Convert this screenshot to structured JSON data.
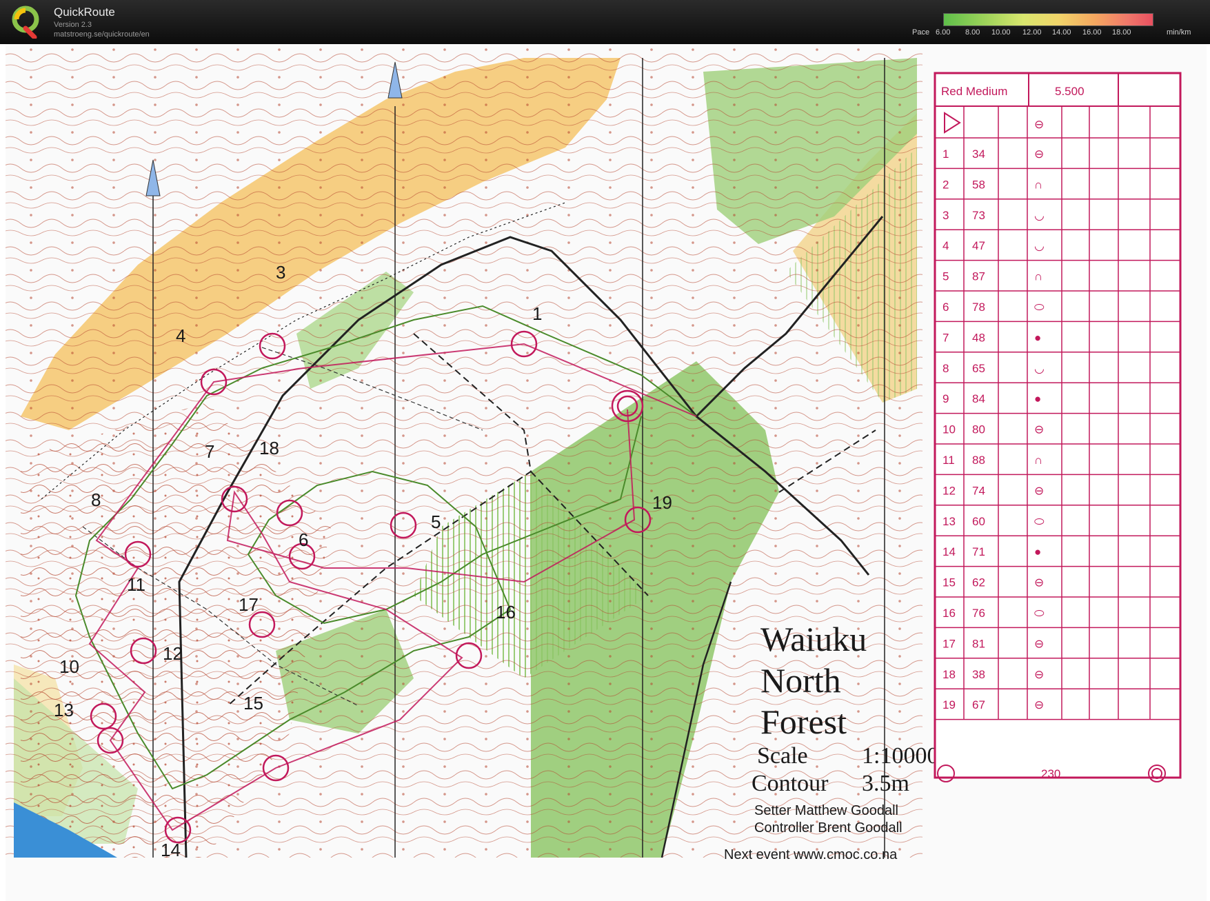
{
  "app": {
    "name": "QuickRoute",
    "version": "Version 2.3",
    "url": "matstroeng.se/quickroute/en"
  },
  "pace_scale": {
    "label": "Pace",
    "ticks": [
      "6.00",
      "8.00",
      "10.00",
      "12.00",
      "14.00",
      "16.00",
      "18.00"
    ],
    "unit": "min/km",
    "colors": [
      "#5fbf4a",
      "#9ed35a",
      "#d9e66e",
      "#f1d46a",
      "#f4a860",
      "#f0786a",
      "#e85060"
    ]
  },
  "map": {
    "title_lines": [
      "Waiuku",
      "North",
      "Forest"
    ],
    "scale_label": "Scale",
    "scale_value": "1:10000",
    "contour_label": "Contour",
    "contour_value": "3.5m",
    "setter": "Setter Matthew Goodall",
    "controller": "Controller Brent Goodall",
    "next_event": "Next event www.cmoc.co.na",
    "control_labels": [
      "1",
      "3",
      "4",
      "5",
      "6",
      "7",
      "8",
      "10",
      "11",
      "12",
      "13",
      "14",
      "15",
      "16",
      "17",
      "18",
      "19"
    ],
    "colors": {
      "course": "#c2185b",
      "contour": "#b5452e",
      "green": "#8fc76a",
      "yellow": "#f2b44c",
      "water": "#3a8fd6"
    }
  },
  "description_sheet": {
    "course": "Red Medium",
    "distance": "5.500",
    "finish_distance": "230",
    "controls": [
      {
        "num": "1",
        "code": "34"
      },
      {
        "num": "2",
        "code": "58"
      },
      {
        "num": "3",
        "code": "73"
      },
      {
        "num": "4",
        "code": "47"
      },
      {
        "num": "5",
        "code": "87"
      },
      {
        "num": "6",
        "code": "78"
      },
      {
        "num": "7",
        "code": "48"
      },
      {
        "num": "8",
        "code": "65"
      },
      {
        "num": "9",
        "code": "84"
      },
      {
        "num": "10",
        "code": "80"
      },
      {
        "num": "11",
        "code": "88"
      },
      {
        "num": "12",
        "code": "74"
      },
      {
        "num": "13",
        "code": "60"
      },
      {
        "num": "14",
        "code": "71"
      },
      {
        "num": "15",
        "code": "62"
      },
      {
        "num": "16",
        "code": "76"
      },
      {
        "num": "17",
        "code": "81"
      },
      {
        "num": "18",
        "code": "38"
      },
      {
        "num": "19",
        "code": "67"
      }
    ],
    "symbols": [
      "⊖",
      "∩",
      "◡",
      "◡",
      "∩",
      "⬭",
      "●",
      "◡",
      "●",
      "⊖",
      "∩",
      "⊖",
      "⬭",
      "●",
      "⊖",
      "⬭",
      "⊖",
      "⊖",
      "⊖"
    ]
  }
}
